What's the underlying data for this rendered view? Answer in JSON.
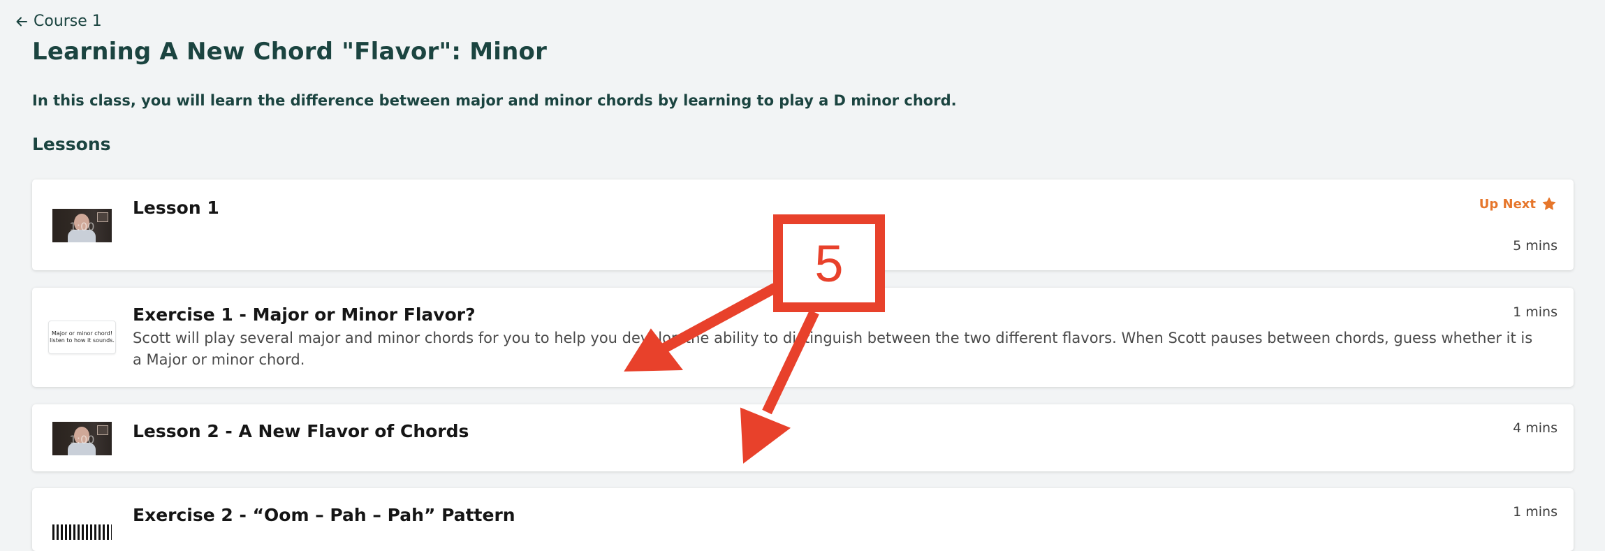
{
  "nav": {
    "back_label": "Course 1",
    "back_icon": "arrow-left-icon"
  },
  "page": {
    "title": "Learning A New Chord \"Flavor\": Minor",
    "intro": "In this class, you will learn the difference between major and minor chords by learning to play a D minor chord.",
    "section_heading": "Lessons"
  },
  "lessons": [
    {
      "title": "Lesson 1",
      "description": "",
      "duration": "5 mins",
      "badge": "Up Next",
      "badge_icon": "star-icon",
      "thumbnail": "video-thumbnail",
      "thumb_overlay": "1:00"
    },
    {
      "title": "Exercise 1 - Major or Minor Flavor?",
      "description": "Scott will play several major and minor chords for you to help you develop the ability to distinguish between the two different flavors. When Scott pauses between chords, guess whether it is a Major or minor chord.",
      "duration": "1 mins",
      "thumbnail": "text-thumbnail",
      "thumb_line_1": "Major or minor chord!",
      "thumb_line_2": "listen to how it sounds."
    },
    {
      "title": "Lesson 2 - A New Flavor of Chords",
      "description": "",
      "duration": "4 mins",
      "thumbnail": "video-thumbnail",
      "thumb_overlay": "1:00"
    },
    {
      "title": "Exercise 2 - “Oom – Pah – Pah” Pattern",
      "description": "",
      "duration": "1 mins",
      "thumbnail": "piano-keys-thumbnail"
    }
  ],
  "annotation": {
    "number": "5",
    "color": "#e8412b"
  },
  "colors": {
    "heading": "#1b4440",
    "accent": "#e6762b",
    "background": "#f2f4f5",
    "card": "#ffffff"
  }
}
